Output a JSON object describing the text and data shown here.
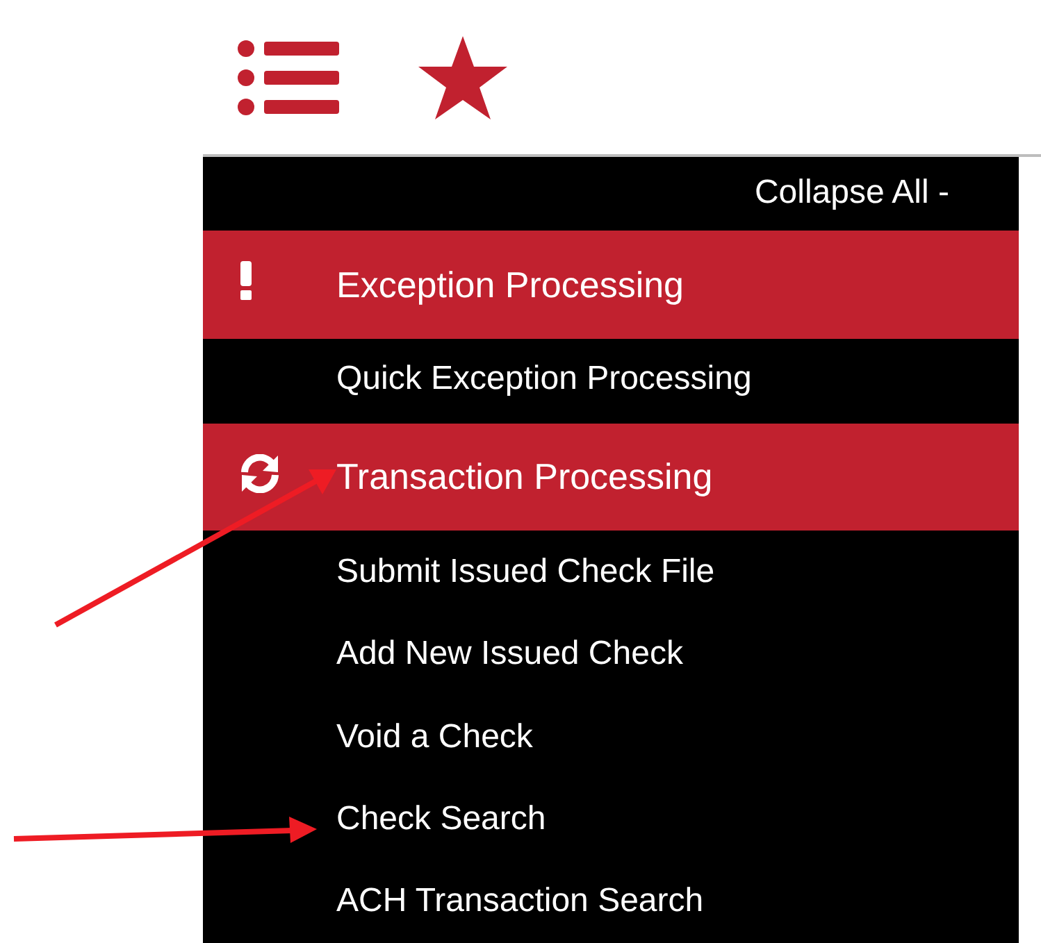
{
  "sidebar": {
    "collapse_all": "Collapse All -",
    "items": [
      {
        "kind": "section",
        "label": "Exception Processing"
      },
      {
        "kind": "link",
        "label": "Quick Exception Processing"
      },
      {
        "kind": "section",
        "label": "Transaction Processing"
      },
      {
        "kind": "link",
        "label": "Submit Issued Check File"
      },
      {
        "kind": "link",
        "label": "Add New Issued Check"
      },
      {
        "kind": "link",
        "label": "Void a Check"
      },
      {
        "kind": "link",
        "label": "Check Search"
      },
      {
        "kind": "link",
        "label": "ACH Transaction Search"
      }
    ]
  }
}
